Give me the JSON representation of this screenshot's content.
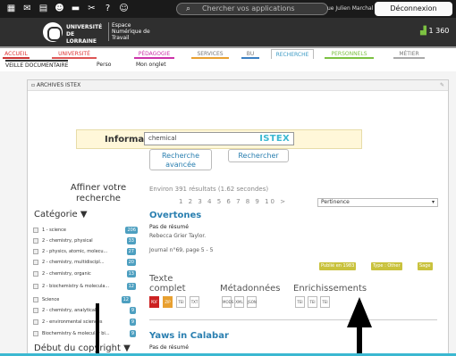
{
  "topbar": {
    "search_placeholder": "Chercher vos applications",
    "user_text": "ue Julien Marchal",
    "logout_label": "Déconnexion"
  },
  "header": {
    "university_name": "UNIVERSITÉ DE LORRAINE",
    "environment_name": "Espace Numérique de Travail",
    "stat_value": "1 360"
  },
  "nav": {
    "items": [
      "ACCUEIL",
      "UNIVERSITÉ",
      "PÉDAGOGIE",
      "SERVICES",
      "BU",
      "RECHERCHE",
      "PERSONNELS",
      "MÉTIER"
    ],
    "sub_items": [
      "VEILLE DOCUMENTAIRE",
      "Perso",
      "Mon onglet"
    ]
  },
  "panel": {
    "title": "ARCHIVES ISTEX",
    "info_label": "Information"
  },
  "search": {
    "value": "chemical",
    "logo": "ISTEX",
    "advanced_label_1": "Recherche",
    "advanced_label_2": "avancée",
    "search_label": "Rechercher"
  },
  "refine": {
    "title_1": "Affiner votre",
    "title_2": "recherche",
    "category_label": "Catégorie",
    "date_label": "Début du copyright",
    "facets": [
      {
        "label": "1 - science",
        "count": "206"
      },
      {
        "label": "2 - chemistry, physical",
        "count": "33"
      },
      {
        "label": "2 - physics, atomic, molecu...",
        "count": "27"
      },
      {
        "label": "2 - chemistry, multidiscipl...",
        "count": "20"
      },
      {
        "label": "2 - chemistry, organic",
        "count": "13"
      },
      {
        "label": "2 - biochemistry & molecula...",
        "count": "12"
      },
      {
        "label": "Science",
        "count": "12"
      },
      {
        "label": "2 - chemistry, analytical",
        "count": "9"
      },
      {
        "label": "2 - environmental sciences",
        "count": "9"
      },
      {
        "label": "Biochemistry & molecular bi...",
        "count": "9"
      }
    ]
  },
  "results": {
    "summary": "Environ 391 résultats (1.62 secondes)",
    "pages": "1 2 3 4 5 6 7 8 9 10 >",
    "sort_value": "Pertinence",
    "items": [
      {
        "title": "Overtones",
        "abstract": "Pas de résumé",
        "author": "Rebecca Grier Taylor.",
        "journal": "Journal n°69, page 5 - 5",
        "tags": [
          "Publié en 1983",
          "Type : Other",
          "Sage"
        ]
      },
      {
        "title": "Yaws in Calabar",
        "abstract": "Pas de résumé"
      }
    ],
    "section_fulltext_1": "Texte",
    "section_fulltext_2": "complet",
    "section_metadata": "Métadonnées",
    "section_enrichments": "Enrichissements"
  }
}
